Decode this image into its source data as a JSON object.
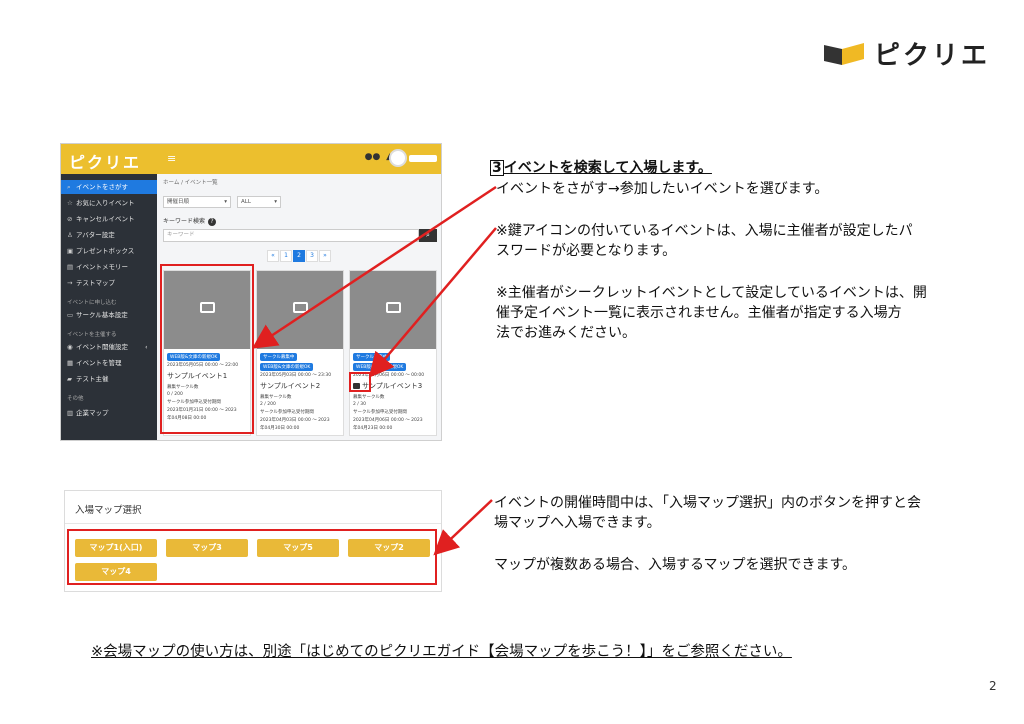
{
  "logo": {
    "text": "ピクリエ",
    "colors": {
      "dark": "#333333",
      "accent": "#f0b924"
    }
  },
  "screenshot1": {
    "brand": "ピクリエ",
    "menu_icon": "≡",
    "sidebar": {
      "items": [
        {
          "label": "イベントをさがす",
          "icon": "search-icon",
          "active": true
        },
        {
          "label": "お気に入りイベント",
          "icon": "star-icon"
        },
        {
          "label": "キャンセルイベント",
          "icon": "ban-icon"
        },
        {
          "label": "アバター設定",
          "icon": "user-icon"
        },
        {
          "label": "プレゼントボックス",
          "icon": "gift-icon"
        },
        {
          "label": "イベントメモリー",
          "icon": "image-icon"
        },
        {
          "label": "テストマップ",
          "icon": "sign-in-icon"
        }
      ],
      "section_apply": "イベントに申し込む",
      "items_apply": [
        {
          "label": "サークル基本設定",
          "icon": "monitor-icon"
        }
      ],
      "section_host": "イベントを主催する",
      "items_host": [
        {
          "label": "イベント開催設定",
          "icon": "globe-icon"
        },
        {
          "label": "イベントを管理",
          "icon": "list-icon"
        },
        {
          "label": "テスト主催",
          "icon": "car-icon"
        }
      ],
      "section_other": "その他",
      "items_other": [
        {
          "label": "企業マップ",
          "icon": "building-icon"
        }
      ]
    },
    "breadcrumb": "ホーム / イベント一覧",
    "filter_order": "開催日順",
    "filter_all": "ALL",
    "keyword_label": "キーワード検索",
    "keyword_placeholder": "キーワード",
    "pager": [
      "«",
      "1",
      "2",
      "3",
      "»"
    ],
    "cards": [
      {
        "badge1": "WEB版&文庫の新規OK",
        "date": "2023年05月05日 00:00 ～ 22:00",
        "name": "サンプルイベント1",
        "line1": "募集サークル数",
        "line2": "0 / 200",
        "line3": "サークル参加申込受付期間",
        "line4": "2023年01月31日 00:00 ～ 2023",
        "line5": "年04月08日 00:00"
      },
      {
        "badge1": "サークル募集中",
        "badge2": "WEB版&文庫の新規OK",
        "date": "2023年05月03日 00:00 ～ 23:30",
        "name": "サンプルイベント2",
        "line1": "募集サークル数",
        "line2": "2 / 200",
        "line3": "サークル参加申込受付期間",
        "line4": "2023年04月03日 00:00 ～ 2023",
        "line5": "年04月30日 00:00"
      },
      {
        "badge1": "サークル募集中",
        "badge2": "WEB版&文庫の新規OK",
        "date": "2023年05月06日 00:00 ～ 00:00",
        "name": "サンプルイベント3",
        "line1": "募集サークル数",
        "line2": "2 / 30",
        "line3": "サークル参加申込受付期間",
        "line4": "2023年04月06日 00:00 ～ 2023",
        "line5": "年04月23日 00:00"
      }
    ]
  },
  "callout1": {
    "number": "3",
    "heading": "イベントを検索して入場します。",
    "line1": "イベントをさがす→参加したいイベントを選びます。",
    "line2": "※鍵アイコンの付いているイベントは、入場に主催者が設定したパ",
    "line3": "スワードが必要となります。",
    "line4": "※主催者がシークレットイベントとして設定しているイベントは、開",
    "line5": "催予定イベント一覧に表示されません。主催者が指定する入場方",
    "line6": "法でお進みください。"
  },
  "screenshot2": {
    "title": "入場マップ選択",
    "buttons": [
      "マップ1(入口)",
      "マップ3",
      "マップ5",
      "マップ2",
      "マップ4"
    ]
  },
  "callout2": {
    "line1": "イベントの開催時間中は、「入場マップ選択」内のボタンを押すと会",
    "line2": "場マップへ入場できます。",
    "line3": "マップが複数ある場合、入場するマップを選択できます。"
  },
  "footer": "※会場マップの使い方は、別途「はじめてのピクリエガイド【会場マップを歩こう！】」をご参照ください。",
  "page_number": "2",
  "colors": {
    "highlight": "#e02020",
    "brand_yellow": "#ecbf2e",
    "link_blue": "#1f7ae0",
    "sidebar": "#2c3138"
  }
}
